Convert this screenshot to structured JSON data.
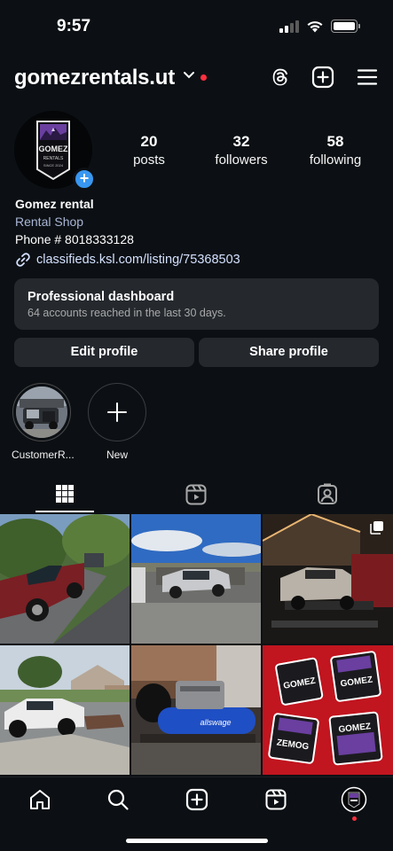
{
  "status_bar": {
    "time": "9:57"
  },
  "header": {
    "username": "gomezrentals.ut"
  },
  "avatar": {
    "logo_lines": [
      "GOMEZ",
      "RENTALS",
      "SINCE 2024"
    ]
  },
  "stats": [
    {
      "count": "20",
      "label": "posts"
    },
    {
      "count": "32",
      "label": "followers"
    },
    {
      "count": "58",
      "label": "following"
    }
  ],
  "bio": {
    "name": "Gomez rental",
    "category": "Rental Shop",
    "phone": "Phone # 8018333128",
    "link": "classifieds.ksl.com/listing/75368503"
  },
  "dashboard": {
    "title": "Professional dashboard",
    "subtitle": "64 accounts reached in the last 30 days."
  },
  "buttons": {
    "edit": "Edit profile",
    "share": "Share profile"
  },
  "highlights": [
    {
      "label": "CustomerR..."
    },
    {
      "label": "New"
    }
  ],
  "tabs": [
    "grid-icon",
    "reels-icon",
    "tagged-icon"
  ],
  "grid_posts": [
    {
      "name": "post-red-truck"
    },
    {
      "name": "post-silver-truck-trailer"
    },
    {
      "name": "post-car-on-trailer-night",
      "multi": true
    },
    {
      "name": "post-white-truck-street"
    },
    {
      "name": "post-air-compressor"
    },
    {
      "name": "post-gomez-stickers"
    }
  ],
  "bottom_nav": [
    "home-icon",
    "search-icon",
    "create-icon",
    "reels-icon",
    "profile-avatar"
  ],
  "colors": {
    "background": "#0c1014",
    "surface": "#25292e",
    "accent_blue": "#3897f0",
    "notification_red": "#ff3040"
  }
}
